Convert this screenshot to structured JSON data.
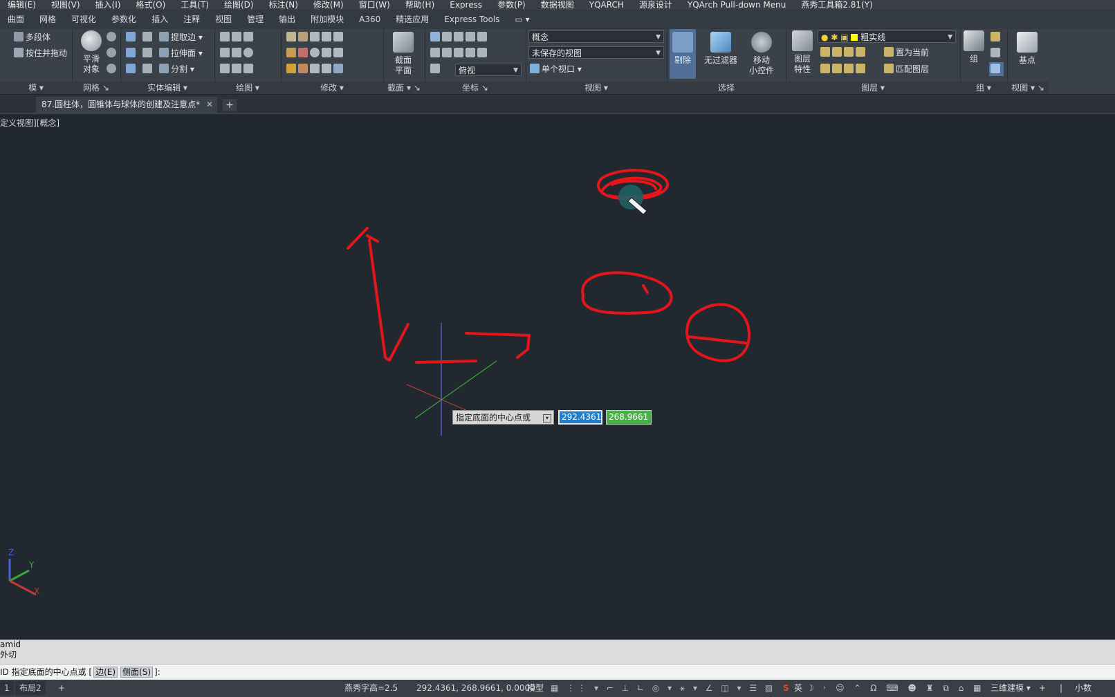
{
  "menubar": [
    "编辑(E)",
    "视图(V)",
    "插入(I)",
    "格式(O)",
    "工具(T)",
    "绘图(D)",
    "标注(N)",
    "修改(M)",
    "窗口(W)",
    "帮助(H)",
    "Express",
    "参数(P)",
    "数据视图",
    "YQARCH",
    "源泉设计",
    "YQArch Pull-down Menu",
    "燕秀工具箱2.81(Y)"
  ],
  "ribbon_tabs": [
    "曲面",
    "网格",
    "可视化",
    "参数化",
    "插入",
    "注释",
    "视图",
    "管理",
    "输出",
    "附加模块",
    "A360",
    "精选应用",
    "Express Tools"
  ],
  "ribbon": {
    "modeling": {
      "title": "模",
      "btn1": "多段体",
      "btn2": "按住并拖动"
    },
    "mesh": {
      "title": "网格",
      "smooth": "平滑\n对象"
    },
    "solid_edit": {
      "title": "实体编辑",
      "extract": "提取边",
      "extrude": "拉伸面",
      "separate": "分割"
    },
    "draw": {
      "title": "绘图"
    },
    "modify": {
      "title": "修改"
    },
    "section": {
      "title": "截面",
      "plane": "截面\n平面"
    },
    "coords": {
      "title": "坐标"
    },
    "view": {
      "title": "视图",
      "visual_style": "概念",
      "named_view": "未保存的视图",
      "ortho": "俯视",
      "viewport": "单个视口"
    },
    "selection": {
      "title": "选择",
      "cull": "剔除",
      "no_filter": "无过滤器",
      "gizmo": "移动\n小控件"
    },
    "layers": {
      "title": "图层",
      "props": "图层\n特性",
      "layer_name": "粗实线",
      "set_current": "置为当前",
      "match": "匹配图层"
    },
    "group": {
      "title": "组",
      "label": "组"
    },
    "view2": {
      "title": "视图",
      "base": "基点"
    }
  },
  "doc_tab": {
    "title": "87.圆柱体，圆锥体与球体的创建及注意点*"
  },
  "viewport": {
    "label": "定义视图][概念]"
  },
  "dynamic_input": {
    "prompt": "指定底面的中心点或",
    "x": "292.4361",
    "y": "268.9661"
  },
  "ucs": {
    "z": "Z",
    "y": "Y",
    "x": "X"
  },
  "command": {
    "history1": "amid",
    "history2": "外切",
    "prompt_prefix": "ID 指定底面的中心点或 [",
    "opt_edge": "边(E)",
    "opt_side": "侧面(S)",
    "prompt_suffix": "]:"
  },
  "status": {
    "layout_tab_prefix": "1",
    "layout2": "布局2",
    "text_height": "燕秀字高=2.5",
    "coords": "292.4361, 268.9661, 0.0000",
    "model": "模型",
    "workspace": "三维建模",
    "units": "小数",
    "ime": "英"
  },
  "colors": {
    "annotation": "#e5161b",
    "background": "#212830",
    "crosshair_blue": "#5a62c9",
    "crosshair_green": "#3fae3a",
    "crosshair_red": "#c23b3b"
  }
}
